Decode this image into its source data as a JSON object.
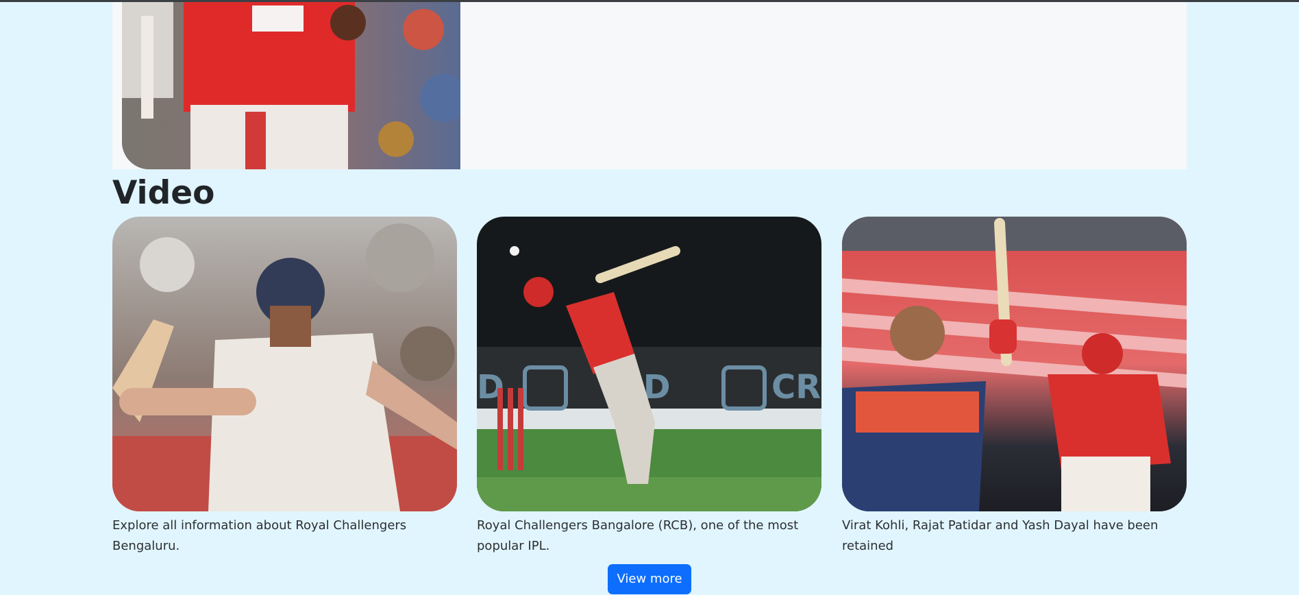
{
  "page": {
    "video_section_title": "Video",
    "view_more_label": "View more"
  },
  "top_card": {
    "image_alt": "Batsman in red jersey with helmet"
  },
  "videos": [
    {
      "image_alt": "Batsman in white jersey celebrating with bat",
      "caption": "Explore all information about Royal Challengers Bengaluru."
    },
    {
      "image_alt": "Batsman in red jersey playing a shot",
      "caption": "Royal Challengers Bangalore (RCB), one of the most popular IPL."
    },
    {
      "image_alt": "Batsman in red jersey raising bat with bowler in blue",
      "caption": "Virat Kohli, Rajat Patidar and Yash Dayal have been retained"
    }
  ]
}
